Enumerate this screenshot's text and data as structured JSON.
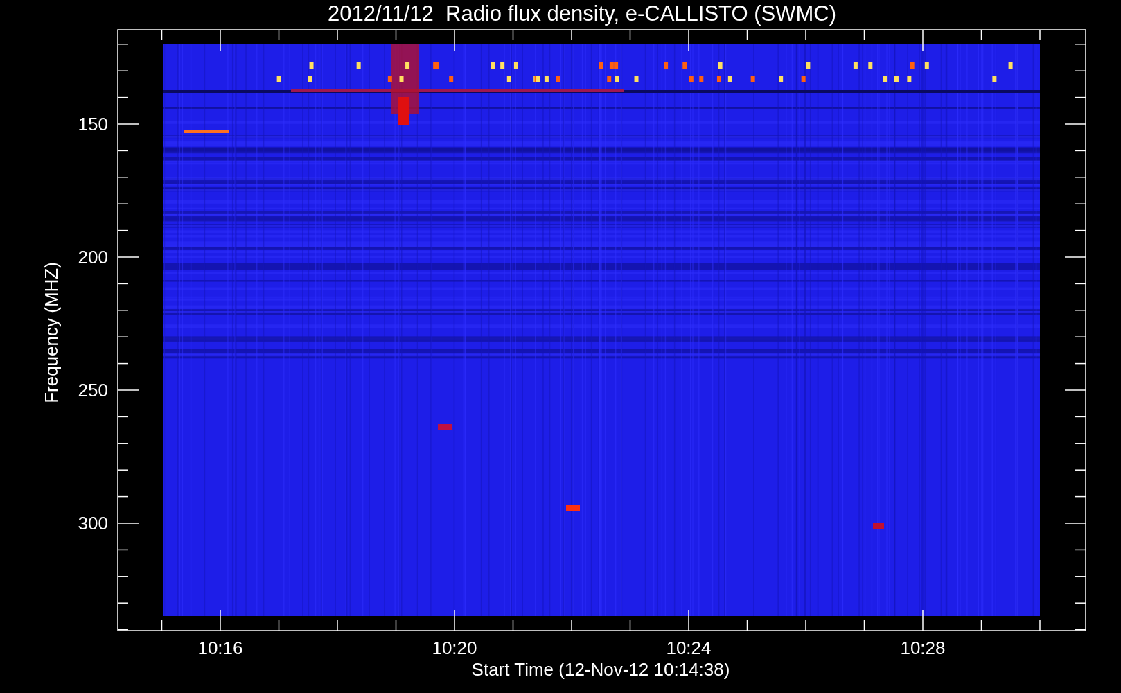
{
  "title": "2012/11/12  Radio flux density, e-CALLISTO (SWMC)",
  "ylabel": "Frequency (MHZ)",
  "xlabel": "Start Time (12-Nov-12 10:14:38)",
  "yticks": [
    "150",
    "200",
    "250",
    "300"
  ],
  "xticks": [
    "10:16",
    "10:20",
    "10:24",
    "10:28"
  ]
}
